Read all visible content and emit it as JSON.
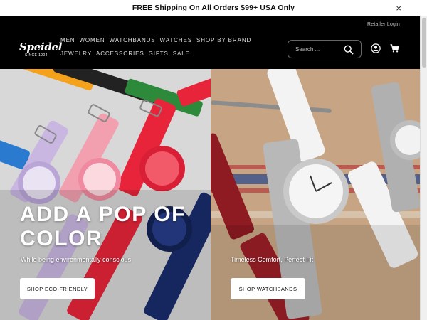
{
  "announcement": {
    "text": "FREE Shipping On All Orders $99+ USA Only",
    "close_glyph": "×"
  },
  "header": {
    "retailer_login": "Retailer Login",
    "logo": {
      "word": "Speidel",
      "since": "SINCE 1904"
    },
    "nav": [
      "MEN",
      "WOMEN",
      "WATCHBANDS",
      "WATCHES",
      "SHOP BY BRAND",
      "JEWELRY",
      "ACCESSORIES",
      "GIFTS",
      "SALE"
    ],
    "search": {
      "placeholder": "Search ..."
    },
    "icons": [
      "search-icon",
      "account-icon",
      "cart-icon"
    ]
  },
  "hero": {
    "left": {
      "title": "ADD A POP OF COLOR",
      "subtitle": "While being environmentally conscious",
      "button": "SHOP ECO-FRIENDLY"
    },
    "right": {
      "subtitle": "Timeless Comfort, Perfect Fit",
      "button": "SHOP WATCHBANDS"
    }
  },
  "colors": {
    "header_bg": "#000000",
    "text_white": "#ffffff",
    "button_bg": "#ffffff"
  }
}
